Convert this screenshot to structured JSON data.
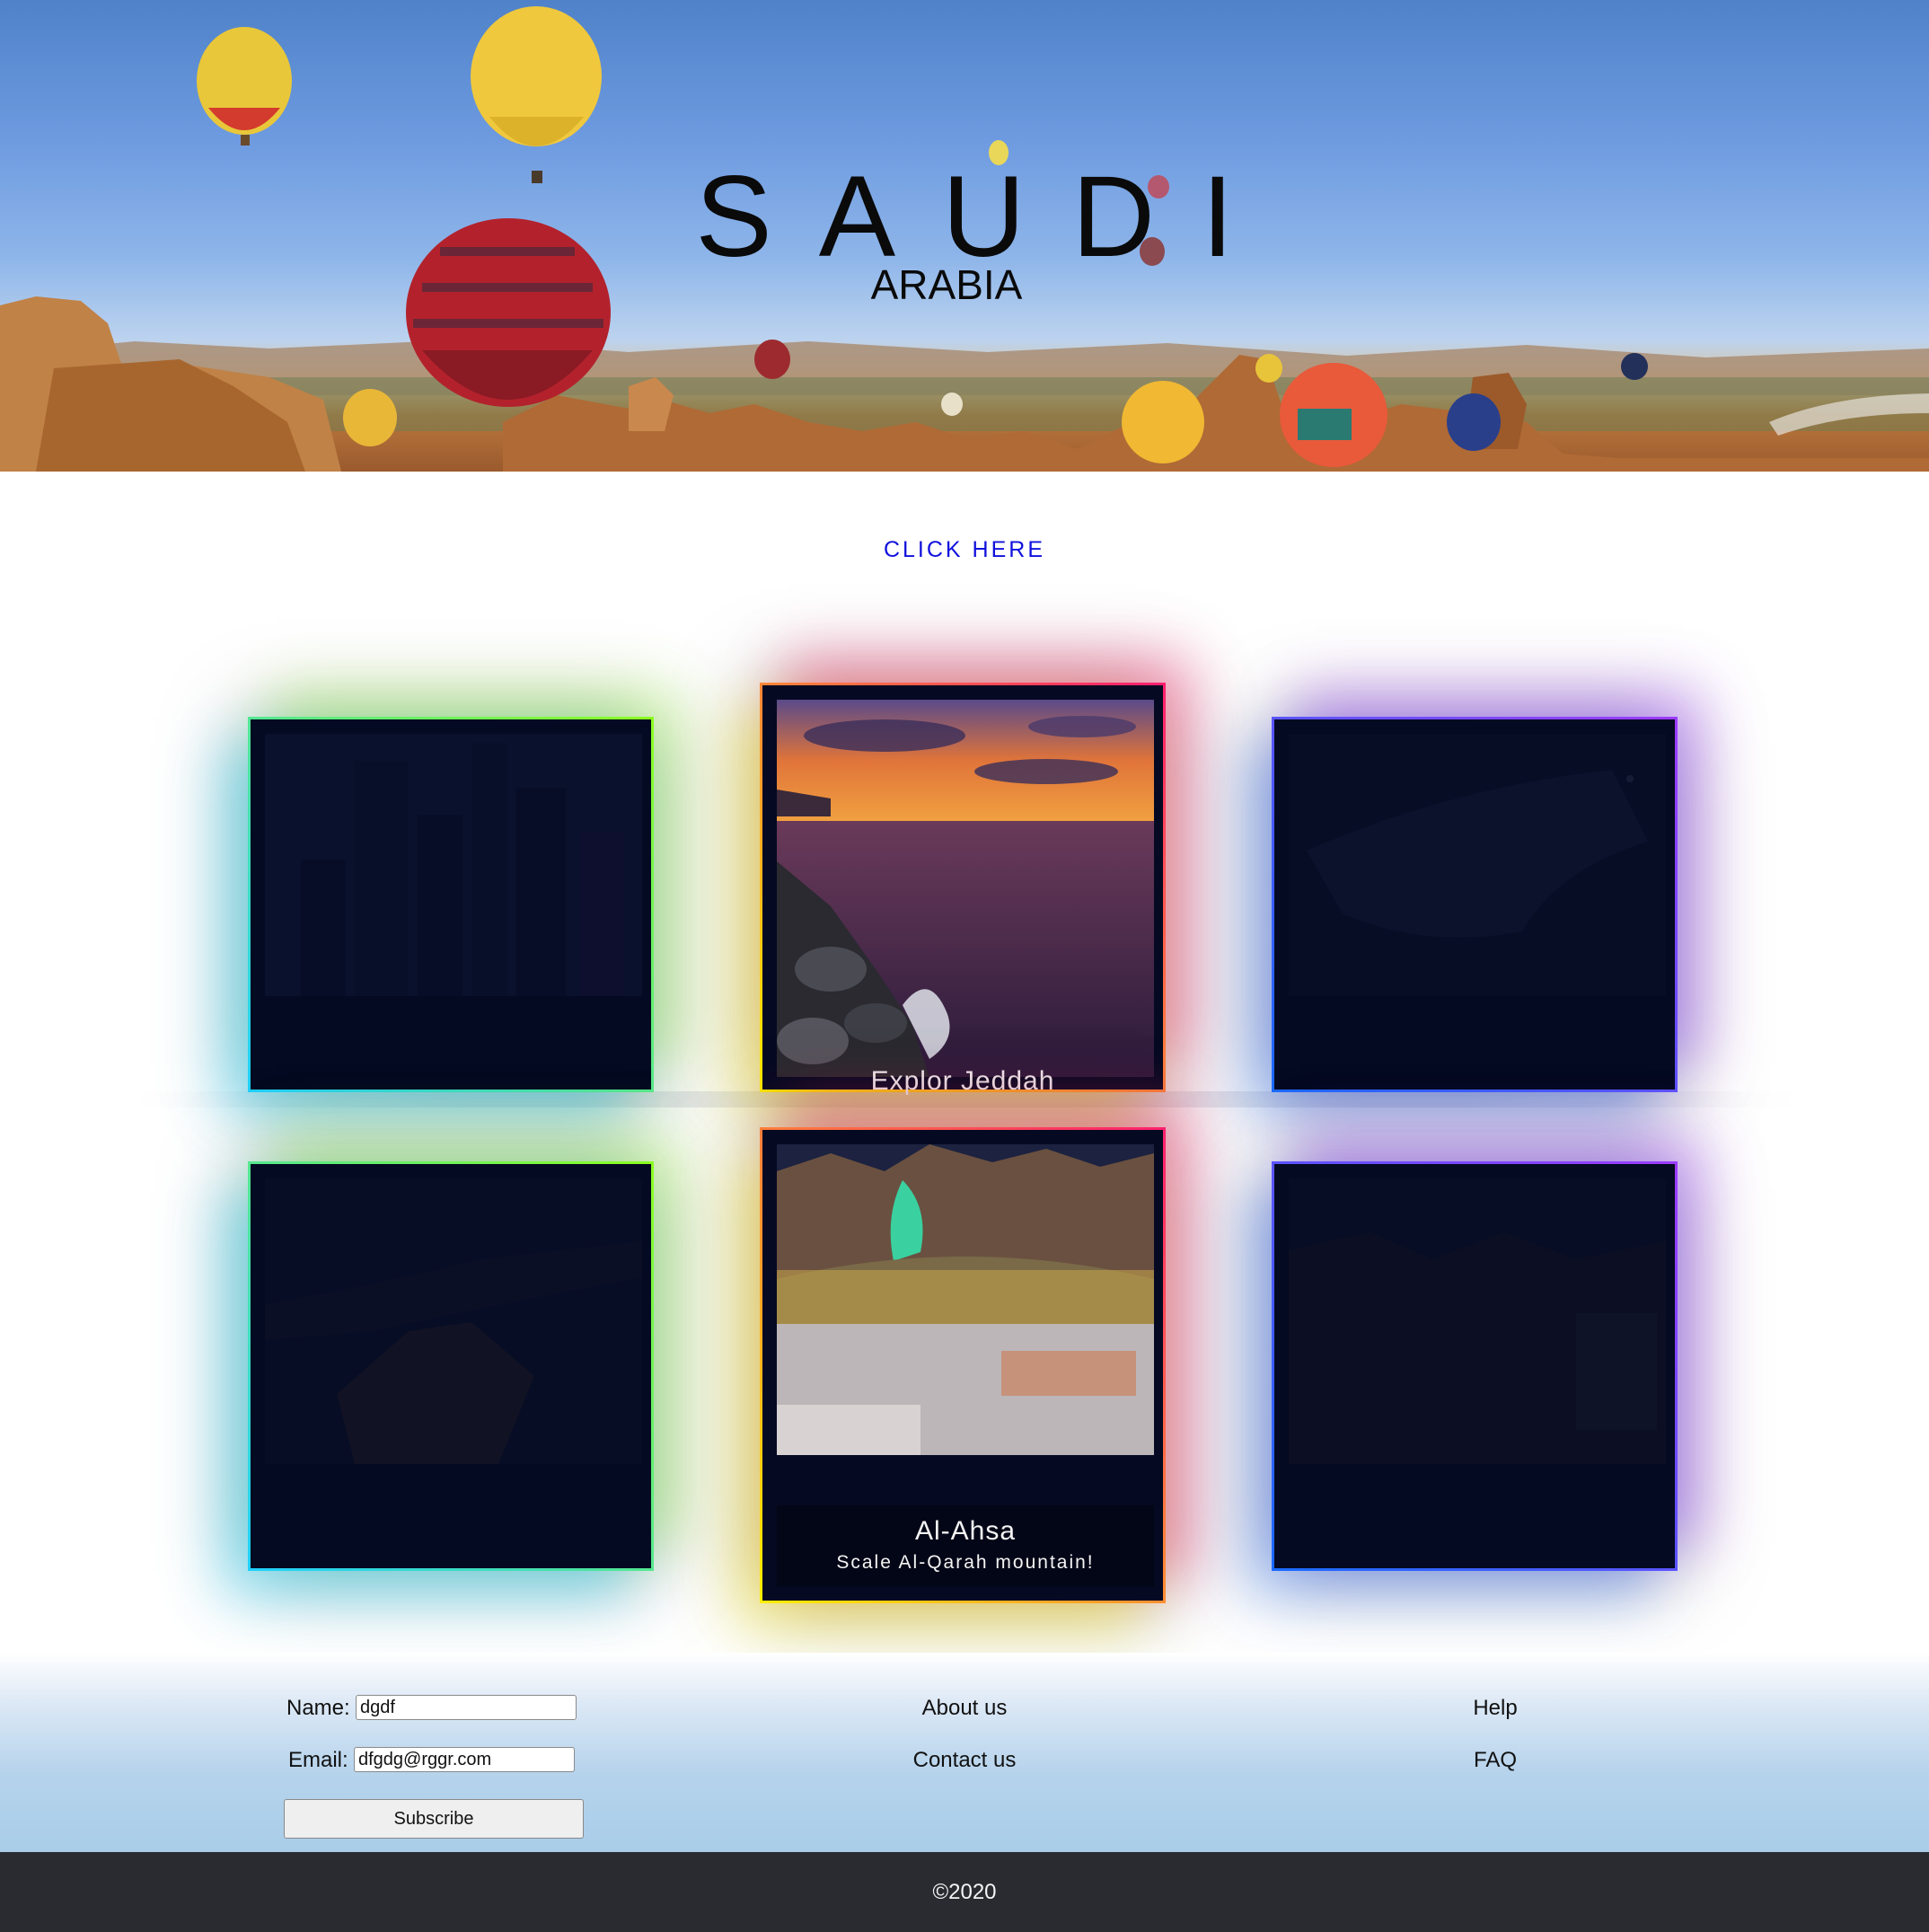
{
  "hero": {
    "title": "SAUDI",
    "subtitle": "ARABIA"
  },
  "cta": {
    "label": "CLICK HERE"
  },
  "cards": {
    "jeddah": {
      "caption": "Explor Jeddah"
    },
    "alahsa": {
      "title": "Al-Ahsa",
      "subtitle": "Scale Al-Qarah mountain!"
    }
  },
  "form": {
    "name_label": "Name:",
    "name_value": "dgdf",
    "email_label": "Email:",
    "email_value": "dfgdg@rggr.com",
    "subscribe_label": "Subscribe"
  },
  "links": {
    "about": "About us",
    "contact": "Contact us",
    "help": "Help",
    "faq": "FAQ"
  },
  "copyright": "©2020",
  "colors": {
    "link": "#1010dd",
    "card_bg": "#050a22",
    "footer_bar": "#292b31"
  }
}
